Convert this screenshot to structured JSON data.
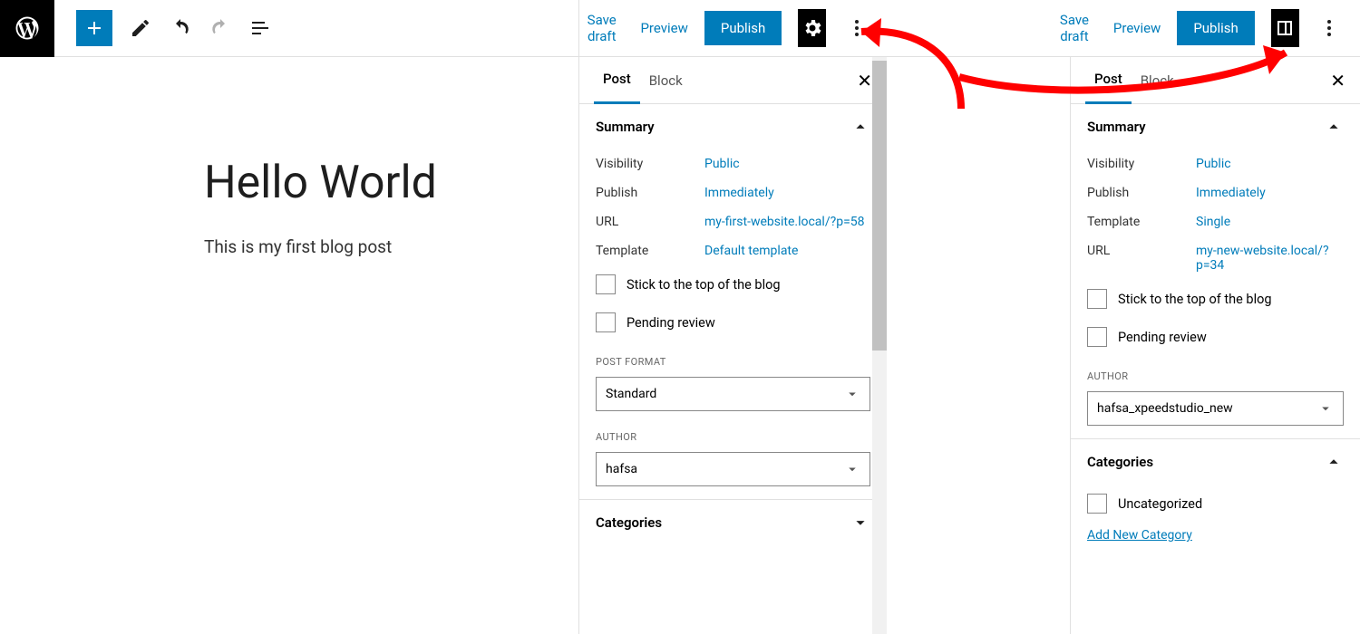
{
  "toolbar": {
    "save_draft": "Save draft",
    "preview": "Preview",
    "publish": "Publish"
  },
  "content": {
    "title": "Hello World",
    "body": "This is my first blog post"
  },
  "panel_left": {
    "tab_post": "Post",
    "tab_block": "Block",
    "summary": "Summary",
    "visibility_k": "Visibility",
    "visibility_v": "Public",
    "publish_k": "Publish",
    "publish_v": "Immediately",
    "url_k": "URL",
    "url_v": "my-first-website.local/?p=58",
    "template_k": "Template",
    "template_v": "Default template",
    "stick": "Stick to the top of the blog",
    "pending": "Pending review",
    "post_format_label": "POST FORMAT",
    "post_format_value": "Standard",
    "author_label": "AUTHOR",
    "author_value": "hafsa",
    "categories": "Categories"
  },
  "panel_right": {
    "tab_post": "Post",
    "tab_block": "Block",
    "summary": "Summary",
    "visibility_k": "Visibility",
    "visibility_v": "Public",
    "publish_k": "Publish",
    "publish_v": "Immediately",
    "template_k": "Template",
    "template_v": "Single",
    "url_k": "URL",
    "url_v": "my-new-website.local/?p=34",
    "stick": "Stick to the top of the blog",
    "pending": "Pending review",
    "author_label": "AUTHOR",
    "author_value": "hafsa_xpeedstudio_new",
    "categories": "Categories",
    "uncategorized": "Uncategorized",
    "add_cat": "Add New Category"
  }
}
